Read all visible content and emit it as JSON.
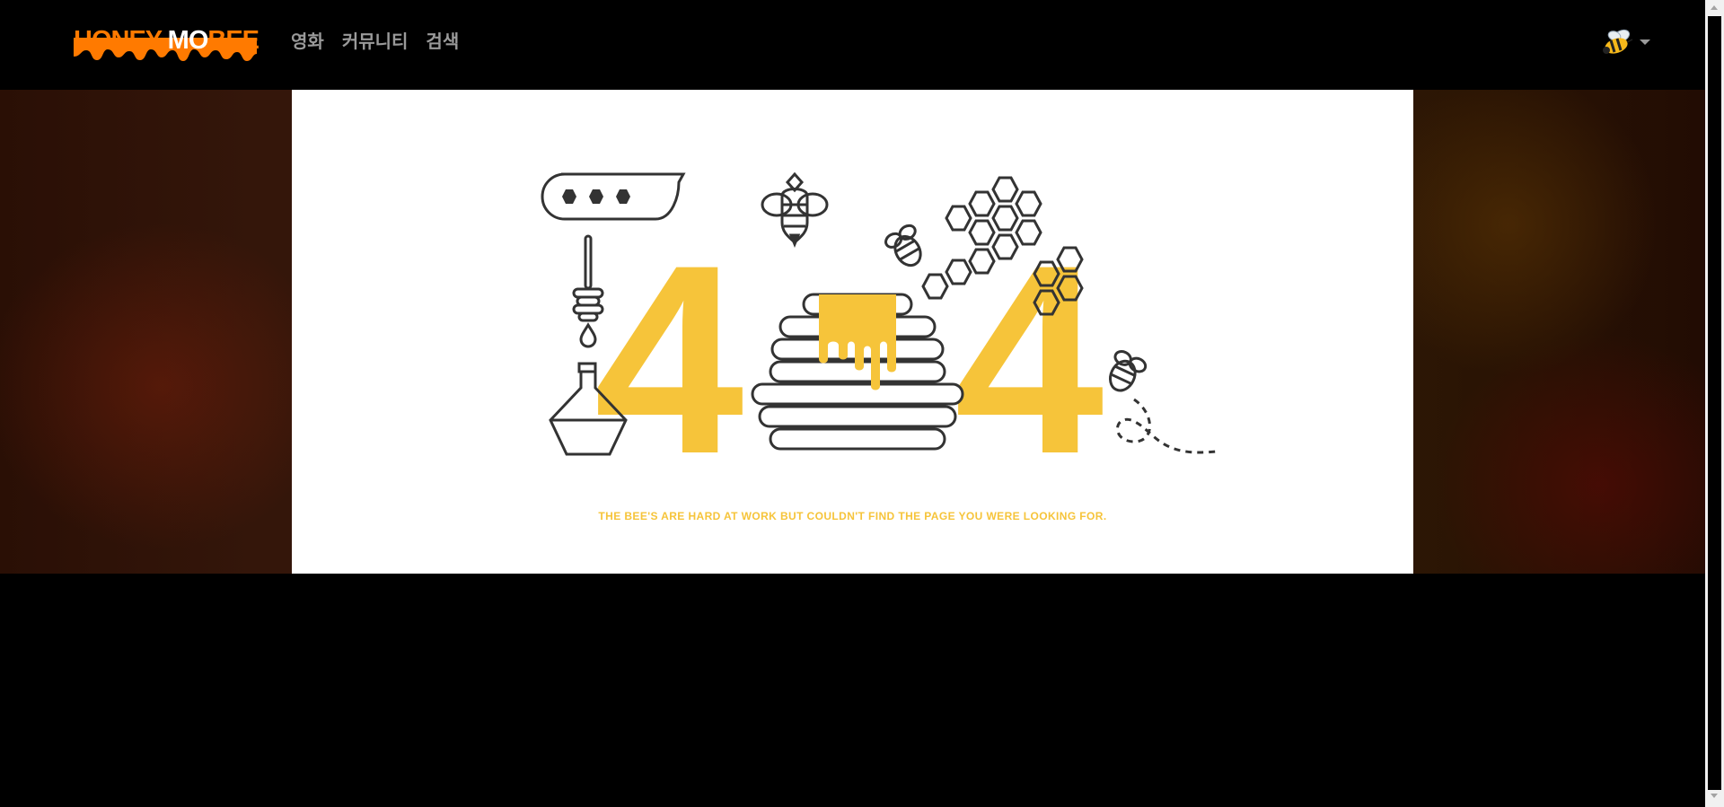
{
  "navbar": {
    "brand": {
      "part1": "HONEY ",
      "part2": "MO",
      "part3": "BEE"
    },
    "links": [
      {
        "label": "영화"
      },
      {
        "label": "커뮤니티"
      },
      {
        "label": "검색"
      }
    ],
    "user_menu_icon": "bee-avatar-icon"
  },
  "error_page": {
    "code_first_digit": "4",
    "code_last_digit": "4",
    "message": "THE BEE'S ARE HARD AT WORK BUT COULDN'T FIND THE PAGE YOU WERE LOOKING FOR."
  },
  "colors": {
    "brand_orange": "#ff7a00",
    "honey_yellow": "#f6c43a",
    "outline": "#333333",
    "nav_text": "#9a9a9a"
  }
}
